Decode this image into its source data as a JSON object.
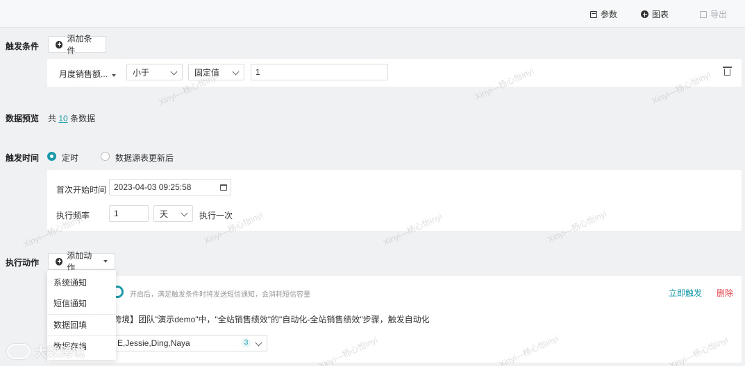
{
  "toolbar": {
    "params_label": "参数",
    "chart_label": "图表",
    "export_label": "导出"
  },
  "condition": {
    "label": "触发条件",
    "add_button": "添加条件",
    "field": "月度销售额...",
    "operator": "小于",
    "value_type": "固定值",
    "value": "1"
  },
  "preview": {
    "label": "数据预览",
    "prefix": "共",
    "count": "10",
    "suffix": "条数据"
  },
  "trigger_time": {
    "label": "触发时间",
    "option_timed": "定时",
    "option_update": "数据源表更新后",
    "selected": "定时",
    "start_label": "首次开始时间",
    "start_value": "2023-04-03 09:25:58",
    "freq_label": "执行频率",
    "freq_value": "1",
    "freq_unit": "天",
    "freq_suffix": "执行一次"
  },
  "action": {
    "label": "执行动作",
    "add_button": "添加动作",
    "menu_items": [
      "系统通知",
      "短信通知",
      "数据回填",
      "数据存档"
    ],
    "hint": "开启后，满足触发条件时将发送短信通知，会消耗短信容量",
    "trigger_now": "立即触发",
    "delete": "删除",
    "message": "跨境】团队\"演示demo\"中，\"全站销售绩效\"的\"自动化-全站销售绩效\"步骤，触发自动化",
    "recipients": "E,Jessie,Ding,Naya",
    "recipient_count": "3"
  },
  "watermark_text": "Xinyi—杨心怡inyi",
  "logo_text": "大数跨境",
  "colors": {
    "accent": "#1a9aa8",
    "danger": "#e0474f"
  }
}
